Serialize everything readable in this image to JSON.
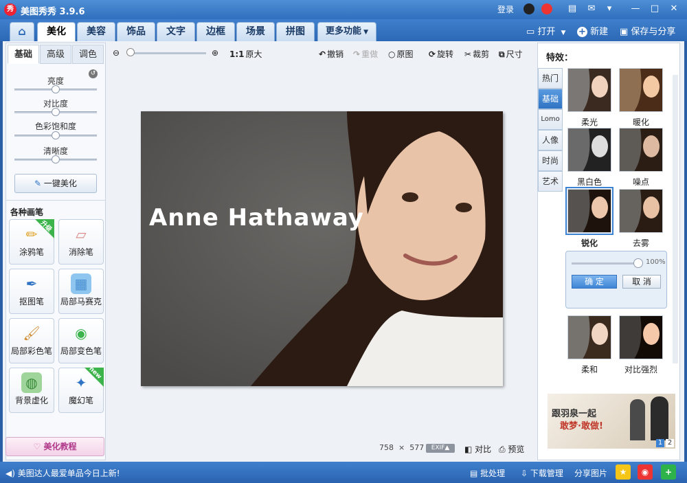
{
  "app": {
    "title": "美图秀秀 3.9.6",
    "logo_text": "秀",
    "login": "登录"
  },
  "nav": {
    "tabs": [
      "美化",
      "美容",
      "饰品",
      "文字",
      "边框",
      "场景",
      "拼图",
      "更多功能"
    ],
    "open": "打开",
    "new": "新建",
    "save_share": "保存与分享"
  },
  "left": {
    "subtabs": [
      "基础",
      "高级",
      "调色"
    ],
    "sliders": [
      "亮度",
      "对比度",
      "色彩饱和度",
      "清晰度"
    ],
    "one_key": "一键美化",
    "brush_title": "各种画笔",
    "tools": [
      {
        "label": "涂鸦笔",
        "badge": "升级"
      },
      {
        "label": "消除笔"
      },
      {
        "label": "抠图笔"
      },
      {
        "label": "局部马赛克"
      },
      {
        "label": "局部彩色笔"
      },
      {
        "label": "局部变色笔"
      },
      {
        "label": "背景虚化"
      },
      {
        "label": "魔幻笔",
        "badge": "new"
      }
    ],
    "tutorial": "美化教程"
  },
  "toolbar": {
    "zoom_ratio": "1:1",
    "original_size": "原大",
    "undo": "撤销",
    "redo": "重做",
    "original": "原图",
    "rotate": "旋转",
    "crop": "裁剪",
    "resize": "尺寸"
  },
  "photo": {
    "caption": "Anne Hathaway"
  },
  "bottom": {
    "width": "758",
    "times": "×",
    "height": "577",
    "exif": "EXIF▲",
    "compare": "对比",
    "preview": "预览"
  },
  "right": {
    "title": "特效：",
    "categories": [
      "热门",
      "基础",
      "Lomo",
      "人像",
      "时尚",
      "艺术"
    ],
    "effects": [
      "柔光",
      "暖化",
      "黑白色",
      "噪点",
      "锐化",
      "去雾",
      "柔和",
      "对比强烈"
    ],
    "intensity": "100%",
    "ok": "确 定",
    "cancel": "取 消",
    "ad_text_1": "跟羽泉一起",
    "ad_text_2": "敢梦·敢做!",
    "ad_pages": [
      "1",
      "2"
    ]
  },
  "status": {
    "news": "美图达人最爱单品今日上新!",
    "batch": "批处理",
    "download": "下载管理",
    "share_pic": "分享图片"
  },
  "colors": {
    "titlebar": "#3a7bc8",
    "active_tab": "#ffffff",
    "accent": "#3c82d2"
  }
}
